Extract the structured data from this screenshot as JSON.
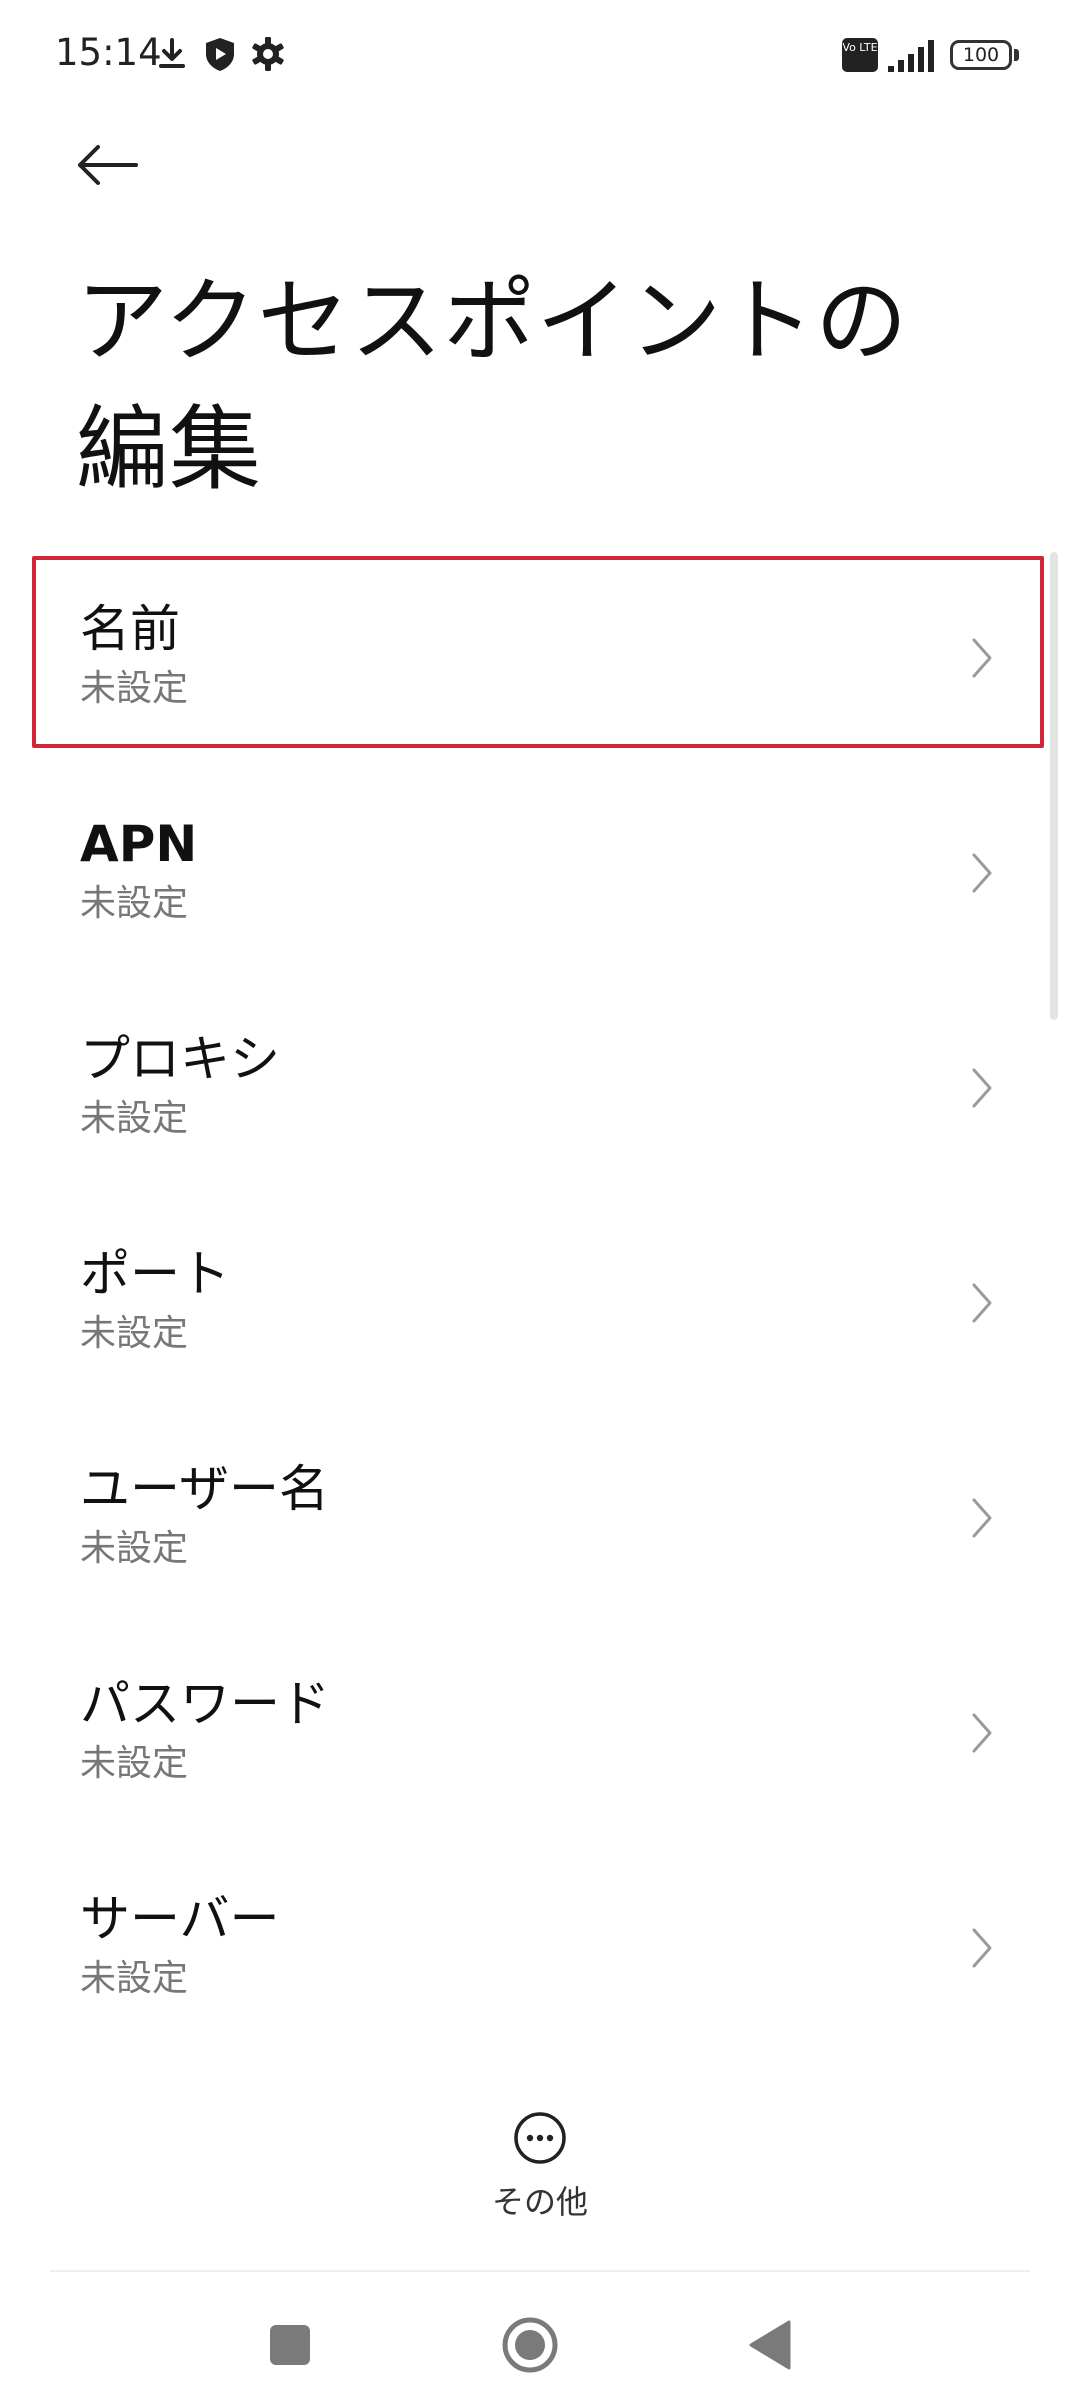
{
  "status_bar": {
    "time": "15:14",
    "icons": [
      "download-icon",
      "shield-icon",
      "gear-icon"
    ],
    "volte_label": "Vo LTE",
    "battery": "100"
  },
  "header": {
    "back_icon": "arrow-left-icon",
    "title": "アクセスポイントの編集"
  },
  "list": {
    "items": [
      {
        "title": "名前",
        "value": "未設定"
      },
      {
        "title": "APN",
        "value": "未設定"
      },
      {
        "title": "プロキシ",
        "value": "未設定"
      },
      {
        "title": "ポート",
        "value": "未設定"
      },
      {
        "title": "ユーザー名",
        "value": "未設定"
      },
      {
        "title": "パスワード",
        "value": "未設定"
      },
      {
        "title": "サーバー",
        "value": "未設定"
      }
    ]
  },
  "more": {
    "label": "その他",
    "icon": "more-horizontal-icon"
  },
  "colors": {
    "highlight": "#d3263a",
    "text": "#111111",
    "subtext": "#777777"
  },
  "nav": [
    "square-icon",
    "home-circle-icon",
    "back-triangle-icon"
  ]
}
